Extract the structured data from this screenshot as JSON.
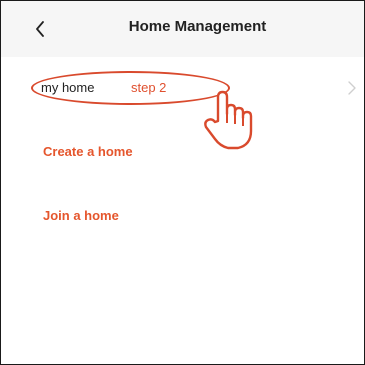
{
  "header": {
    "title": "Home Management",
    "back_icon": "chevron-left-icon"
  },
  "homes": [
    {
      "name": "my home",
      "chevron_icon": "chevron-right-icon"
    }
  ],
  "annotation": {
    "step_label": "step 2",
    "cursor_icon": "hand-pointer-icon",
    "color": "#d94a2d"
  },
  "actions": {
    "create_label": "Create a home",
    "join_label": "Join a home",
    "color": "#e5562d"
  }
}
